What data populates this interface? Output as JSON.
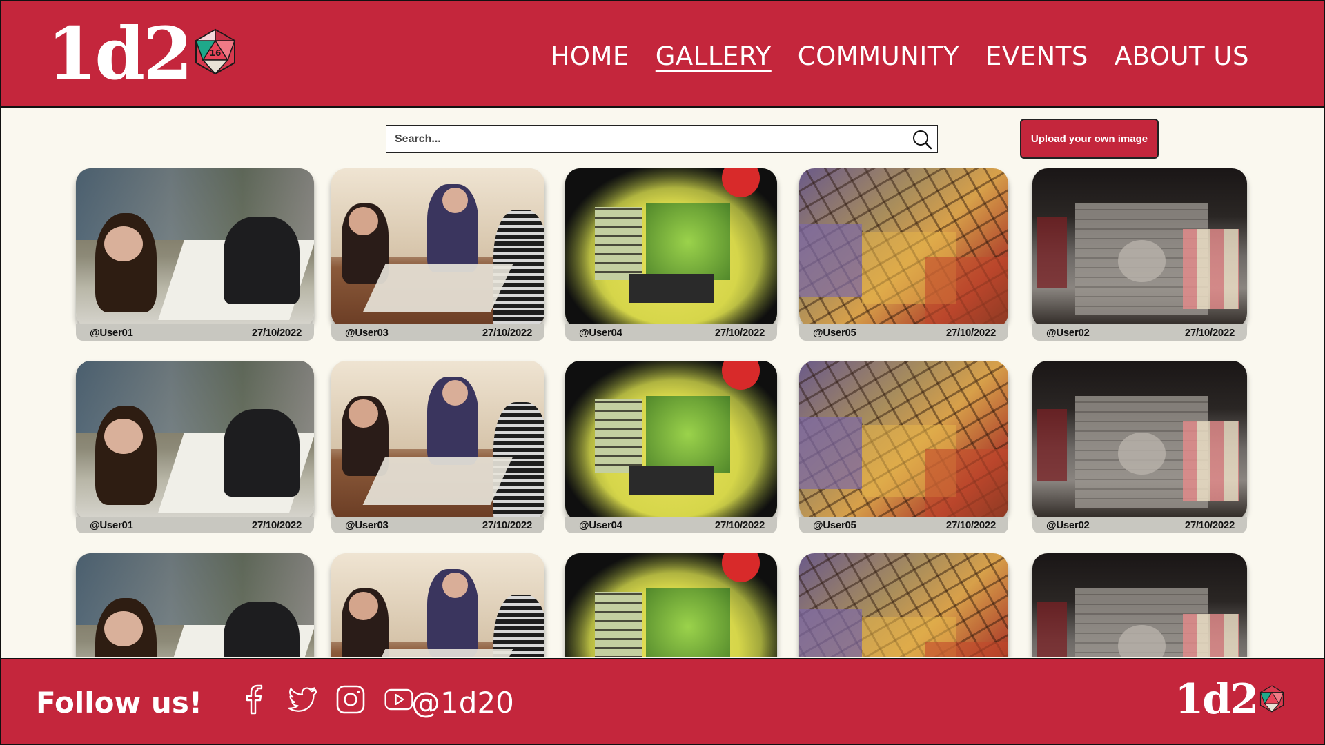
{
  "brand": {
    "logo_text": "1d2",
    "die_face": "16",
    "accent": "#c4263c",
    "background": "#faf8ef"
  },
  "nav": {
    "items": [
      {
        "label": "HOME",
        "active": false
      },
      {
        "label": "GALLERY",
        "active": true
      },
      {
        "label": "COMMUNITY",
        "active": false
      },
      {
        "label": "EVENTS",
        "active": false
      },
      {
        "label": "ABOUT US",
        "active": false
      }
    ]
  },
  "toolbar": {
    "search_placeholder": "Search...",
    "search_icon": "search-icon",
    "upload_label": "Upload your own image"
  },
  "gallery": {
    "rows": [
      {
        "cards": [
          {
            "user": "@User01",
            "date": "27/10/2022"
          },
          {
            "user": "@User03",
            "date": "27/10/2022"
          },
          {
            "user": "@User04",
            "date": "27/10/2022"
          },
          {
            "user": "@User05",
            "date": "27/10/2022"
          },
          {
            "user": "@User02",
            "date": "27/10/2022"
          }
        ]
      },
      {
        "cards": [
          {
            "user": "@User01",
            "date": "27/10/2022"
          },
          {
            "user": "@User03",
            "date": "27/10/2022"
          },
          {
            "user": "@User04",
            "date": "27/10/2022"
          },
          {
            "user": "@User05",
            "date": "27/10/2022"
          },
          {
            "user": "@User02",
            "date": "27/10/2022"
          }
        ]
      },
      {
        "cards": [
          {
            "user": "",
            "date": ""
          },
          {
            "user": "",
            "date": ""
          },
          {
            "user": "",
            "date": ""
          },
          {
            "user": "",
            "date": ""
          },
          {
            "user": "",
            "date": ""
          }
        ]
      }
    ]
  },
  "footer": {
    "follow_label": "Follow us!",
    "socials": [
      "facebook-icon",
      "twitter-icon",
      "instagram-icon",
      "youtube-icon"
    ],
    "handle": "@1d20",
    "logo_text": "1d2"
  }
}
